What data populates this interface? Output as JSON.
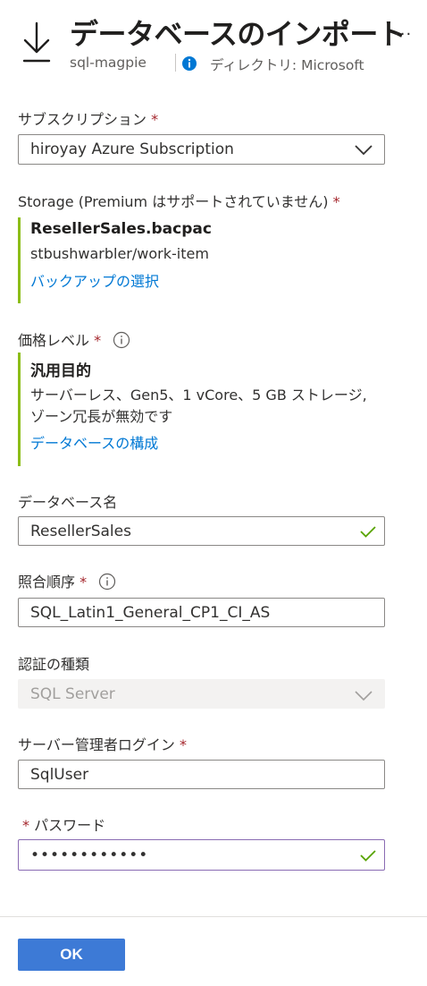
{
  "header": {
    "title": "データベースのインポート",
    "subtitle": "sql-magpie",
    "directory": "ディレクトリ: Microsoft",
    "more": "..."
  },
  "subscription": {
    "label": "サブスクリプション",
    "value": "hiroyay Azure Subscription"
  },
  "storage": {
    "label": "Storage (Premium はサポートされていません)",
    "file": "ResellerSales.bacpac",
    "path": "stbushwarbler/work-item",
    "link": "バックアップの選択"
  },
  "pricing": {
    "label": "価格レベル",
    "tier": "汎用目的",
    "detail": "サーバーレス、Gen5、1 vCore、5 GB ストレージ, ゾーン冗長が無効です",
    "link": "データベースの構成"
  },
  "database": {
    "label": "データベース名",
    "value": "ResellerSales"
  },
  "collation": {
    "label": "照合順序",
    "value": "SQL_Latin1_General_CP1_CI_AS"
  },
  "auth": {
    "label": "認証の種類",
    "value": "SQL Server"
  },
  "login": {
    "label": "サーバー管理者ログイン",
    "value": "SqlUser"
  },
  "password": {
    "label": "パスワード",
    "value": "••••••••••••"
  },
  "required_mark": "*",
  "footer": {
    "ok_label": "OK"
  },
  "colors": {
    "accent": "#0078d4",
    "ok_button": "#3d7ad6",
    "card_border": "#8cbd18",
    "valid_check": "#57a300",
    "required": "#a4262c"
  }
}
